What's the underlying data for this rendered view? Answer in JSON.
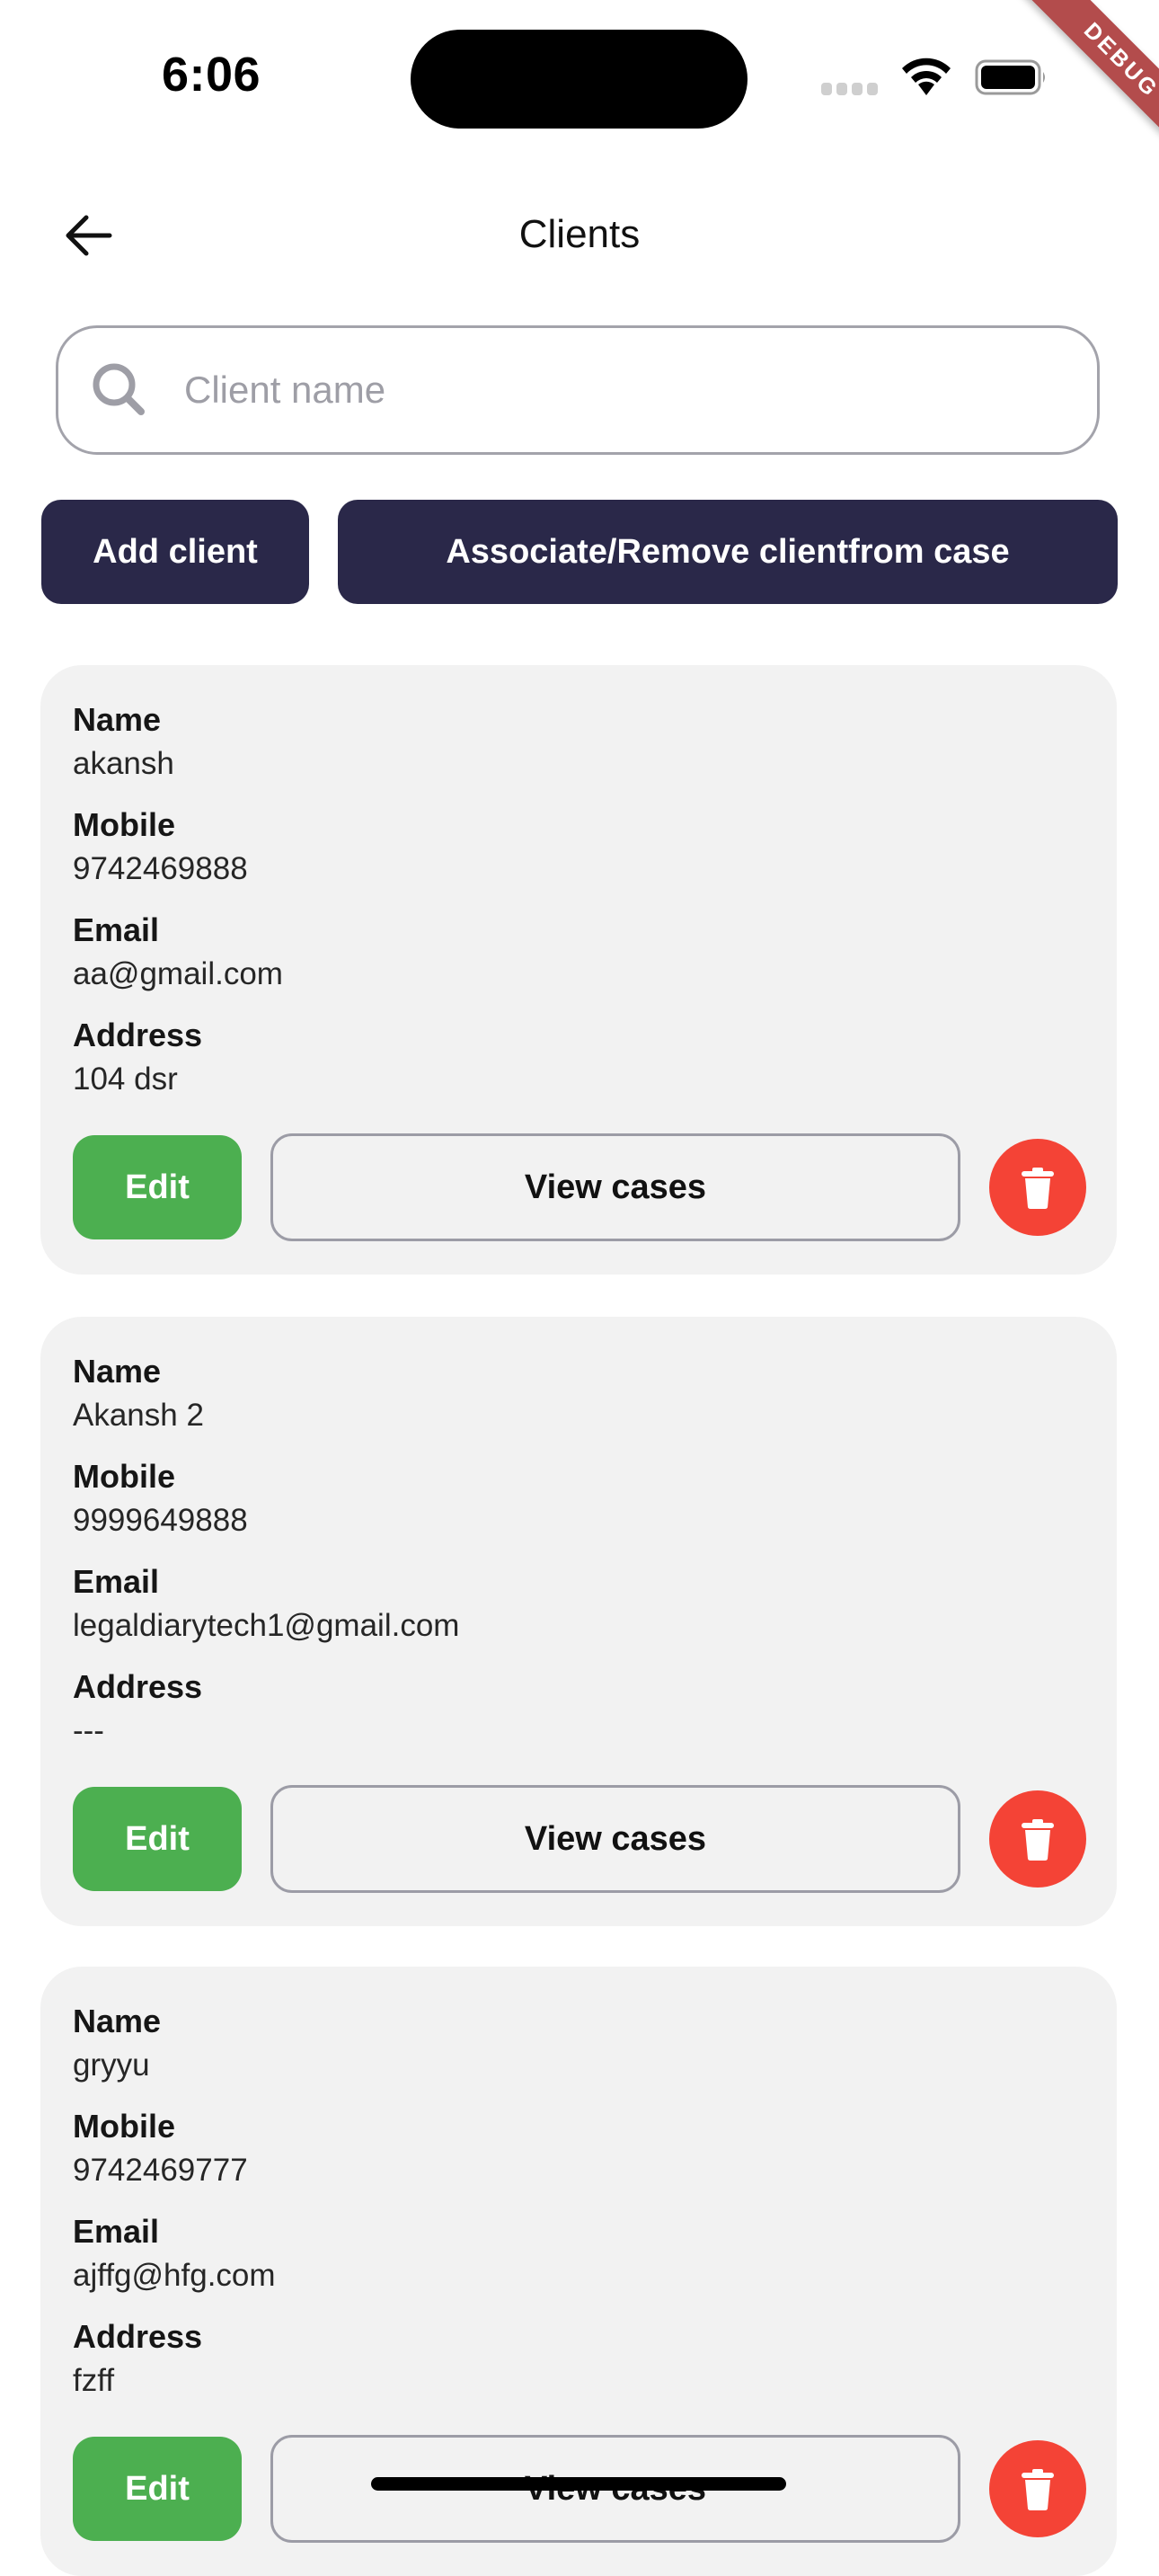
{
  "status_bar": {
    "time": "6:06",
    "debug_banner": "DEBUG"
  },
  "app_bar": {
    "title": "Clients",
    "back_icon": "arrow-left-icon"
  },
  "search": {
    "placeholder": "Client name",
    "value": "",
    "icon": "search-icon"
  },
  "actions": {
    "add_client_label": "Add client",
    "associate_label": "Associate/Remove clientfrom case"
  },
  "labels": {
    "name": "Name",
    "mobile": "Mobile",
    "email": "Email",
    "address": "Address",
    "edit": "Edit",
    "view_cases": "View cases"
  },
  "colors": {
    "primary_dark": "#2a2849",
    "edit_green": "#4caf50",
    "delete_red": "#f44336",
    "card_bg": "#f2f2f2"
  },
  "clients": [
    {
      "name": "akansh",
      "mobile": "9742469888",
      "email": "aa@gmail.com",
      "address": "104 dsr"
    },
    {
      "name": "Akansh 2",
      "mobile": "9999649888",
      "email": "legaldiarytech1@gmail.com",
      "address": "---"
    },
    {
      "name": "gryyu",
      "mobile": "9742469777",
      "email": "ajffg@hfg.com",
      "address": "fzff"
    }
  ]
}
